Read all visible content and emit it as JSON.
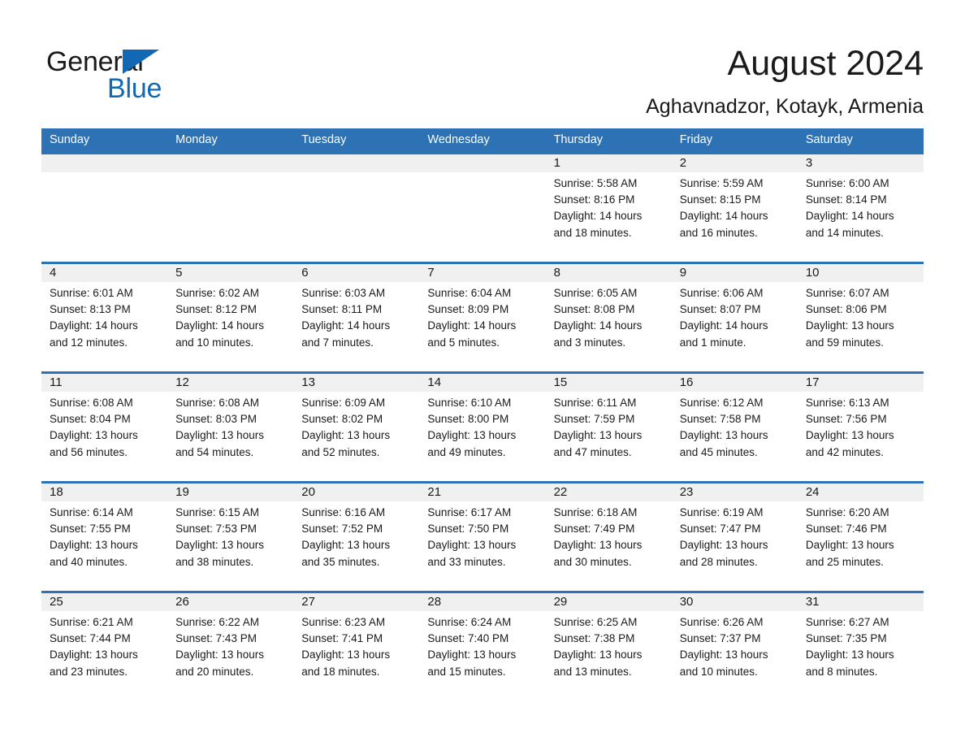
{
  "brand": {
    "name_part1": "General",
    "name_part2": "Blue",
    "accent_color": "#1268b3"
  },
  "header": {
    "month_title": "August 2024",
    "location": "Aghavnadzor, Kotayk, Armenia"
  },
  "calendar": {
    "header_color": "#2c72b4",
    "daynum_band_color": "#f0f0f0",
    "weekday_headers": [
      "Sunday",
      "Monday",
      "Tuesday",
      "Wednesday",
      "Thursday",
      "Friday",
      "Saturday"
    ],
    "weeks": [
      [
        {
          "day": "",
          "info": ""
        },
        {
          "day": "",
          "info": ""
        },
        {
          "day": "",
          "info": ""
        },
        {
          "day": "",
          "info": ""
        },
        {
          "day": "1",
          "info": "Sunrise: 5:58 AM\nSunset: 8:16 PM\nDaylight: 14 hours\nand 18 minutes."
        },
        {
          "day": "2",
          "info": "Sunrise: 5:59 AM\nSunset: 8:15 PM\nDaylight: 14 hours\nand 16 minutes."
        },
        {
          "day": "3",
          "info": "Sunrise: 6:00 AM\nSunset: 8:14 PM\nDaylight: 14 hours\nand 14 minutes."
        }
      ],
      [
        {
          "day": "4",
          "info": "Sunrise: 6:01 AM\nSunset: 8:13 PM\nDaylight: 14 hours\nand 12 minutes."
        },
        {
          "day": "5",
          "info": "Sunrise: 6:02 AM\nSunset: 8:12 PM\nDaylight: 14 hours\nand 10 minutes."
        },
        {
          "day": "6",
          "info": "Sunrise: 6:03 AM\nSunset: 8:11 PM\nDaylight: 14 hours\nand 7 minutes."
        },
        {
          "day": "7",
          "info": "Sunrise: 6:04 AM\nSunset: 8:09 PM\nDaylight: 14 hours\nand 5 minutes."
        },
        {
          "day": "8",
          "info": "Sunrise: 6:05 AM\nSunset: 8:08 PM\nDaylight: 14 hours\nand 3 minutes."
        },
        {
          "day": "9",
          "info": "Sunrise: 6:06 AM\nSunset: 8:07 PM\nDaylight: 14 hours\nand 1 minute."
        },
        {
          "day": "10",
          "info": "Sunrise: 6:07 AM\nSunset: 8:06 PM\nDaylight: 13 hours\nand 59 minutes."
        }
      ],
      [
        {
          "day": "11",
          "info": "Sunrise: 6:08 AM\nSunset: 8:04 PM\nDaylight: 13 hours\nand 56 minutes."
        },
        {
          "day": "12",
          "info": "Sunrise: 6:08 AM\nSunset: 8:03 PM\nDaylight: 13 hours\nand 54 minutes."
        },
        {
          "day": "13",
          "info": "Sunrise: 6:09 AM\nSunset: 8:02 PM\nDaylight: 13 hours\nand 52 minutes."
        },
        {
          "day": "14",
          "info": "Sunrise: 6:10 AM\nSunset: 8:00 PM\nDaylight: 13 hours\nand 49 minutes."
        },
        {
          "day": "15",
          "info": "Sunrise: 6:11 AM\nSunset: 7:59 PM\nDaylight: 13 hours\nand 47 minutes."
        },
        {
          "day": "16",
          "info": "Sunrise: 6:12 AM\nSunset: 7:58 PM\nDaylight: 13 hours\nand 45 minutes."
        },
        {
          "day": "17",
          "info": "Sunrise: 6:13 AM\nSunset: 7:56 PM\nDaylight: 13 hours\nand 42 minutes."
        }
      ],
      [
        {
          "day": "18",
          "info": "Sunrise: 6:14 AM\nSunset: 7:55 PM\nDaylight: 13 hours\nand 40 minutes."
        },
        {
          "day": "19",
          "info": "Sunrise: 6:15 AM\nSunset: 7:53 PM\nDaylight: 13 hours\nand 38 minutes."
        },
        {
          "day": "20",
          "info": "Sunrise: 6:16 AM\nSunset: 7:52 PM\nDaylight: 13 hours\nand 35 minutes."
        },
        {
          "day": "21",
          "info": "Sunrise: 6:17 AM\nSunset: 7:50 PM\nDaylight: 13 hours\nand 33 minutes."
        },
        {
          "day": "22",
          "info": "Sunrise: 6:18 AM\nSunset: 7:49 PM\nDaylight: 13 hours\nand 30 minutes."
        },
        {
          "day": "23",
          "info": "Sunrise: 6:19 AM\nSunset: 7:47 PM\nDaylight: 13 hours\nand 28 minutes."
        },
        {
          "day": "24",
          "info": "Sunrise: 6:20 AM\nSunset: 7:46 PM\nDaylight: 13 hours\nand 25 minutes."
        }
      ],
      [
        {
          "day": "25",
          "info": "Sunrise: 6:21 AM\nSunset: 7:44 PM\nDaylight: 13 hours\nand 23 minutes."
        },
        {
          "day": "26",
          "info": "Sunrise: 6:22 AM\nSunset: 7:43 PM\nDaylight: 13 hours\nand 20 minutes."
        },
        {
          "day": "27",
          "info": "Sunrise: 6:23 AM\nSunset: 7:41 PM\nDaylight: 13 hours\nand 18 minutes."
        },
        {
          "day": "28",
          "info": "Sunrise: 6:24 AM\nSunset: 7:40 PM\nDaylight: 13 hours\nand 15 minutes."
        },
        {
          "day": "29",
          "info": "Sunrise: 6:25 AM\nSunset: 7:38 PM\nDaylight: 13 hours\nand 13 minutes."
        },
        {
          "day": "30",
          "info": "Sunrise: 6:26 AM\nSunset: 7:37 PM\nDaylight: 13 hours\nand 10 minutes."
        },
        {
          "day": "31",
          "info": "Sunrise: 6:27 AM\nSunset: 7:35 PM\nDaylight: 13 hours\nand 8 minutes."
        }
      ]
    ]
  }
}
